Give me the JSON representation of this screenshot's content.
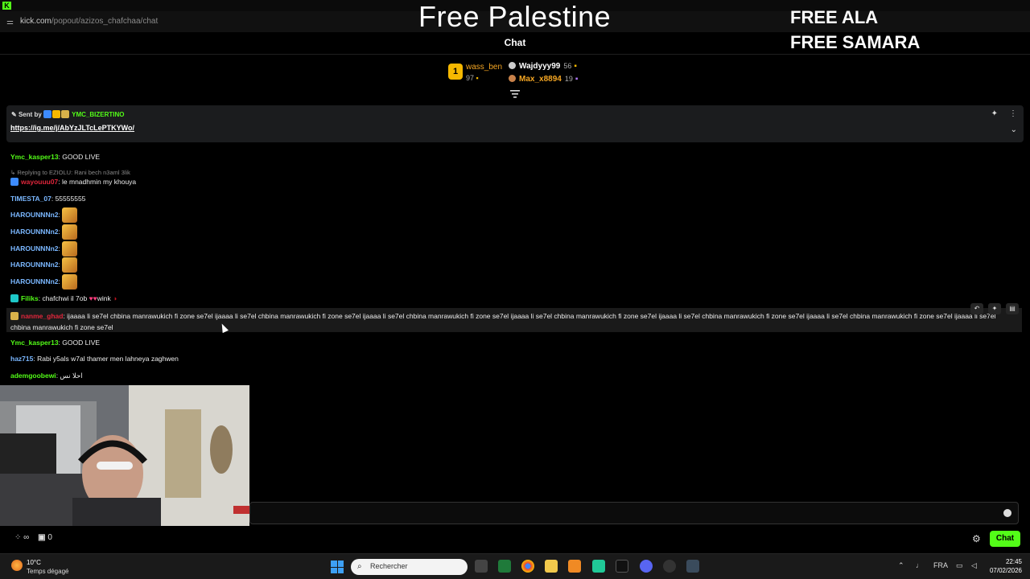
{
  "browser": {
    "url_host": "kick.com",
    "url_path": "/popout/azizos_chafchaa/chat"
  },
  "overlay": {
    "title": "Free Palestine",
    "right_lines": [
      "FREE ALA",
      "FREE SAMARA"
    ]
  },
  "chat_header": {
    "title": "Chat"
  },
  "leaderboard": {
    "first": {
      "rank": "1",
      "name": "wass_ben",
      "count": "97"
    },
    "others": [
      {
        "name": "Wajdyyy99",
        "count": "56",
        "color": "#ffffff"
      },
      {
        "name": "Max_x8894",
        "count": "19",
        "color": "#f5a623"
      }
    ]
  },
  "pinned": {
    "sent_by_label": "Sent by",
    "user": "YMC_BIZERTINO",
    "link": "https://ig.me/j/AbYzJLTcLePTKYWo/"
  },
  "messages": [
    {
      "user": "Ymc_kasper13",
      "color": "#53fc18",
      "text": ": GOOD LIVE"
    },
    {
      "reply": "Replying to EZIOLU: Rani bech n3aml 3lik"
    },
    {
      "user": "wayouuu07",
      "color": "#e0263b",
      "text": ": le mnadhmin my khouya"
    },
    {
      "user": "TIMESTA_07",
      "color": "#ffffff",
      "text": ": 55555555"
    },
    {
      "user": "HAROUNNNn2",
      "color": "#7ab7ff",
      "text": ":"
    },
    {
      "user": "HAROUNNNn2",
      "color": "#7ab7ff",
      "text": ":"
    },
    {
      "user": "HAROUNNNn2",
      "color": "#7ab7ff",
      "text": ":"
    },
    {
      "user": "HAROUNNNn2",
      "color": "#7ab7ff",
      "text": ":"
    },
    {
      "user": "HAROUNNNn2",
      "color": "#7ab7ff",
      "text": ":"
    },
    {
      "user": "Filiks",
      "color": "#53fc18",
      "text": ": chafchwi il 7ob",
      "tail": "wink"
    }
  ],
  "highlighted": {
    "user": "nanme_ghad",
    "text": ": ijaaaa li se7el chbina manrawukich fi zone se7el ijaaaa li se7el chbina manrawukich fi zone se7el ijaaaa li se7el chbina manrawukich fi zone se7el ijaaaa li se7el chbina manrawukich fi zone se7el ijaaaa li se7el chbina manrawukich fi zone se7el ijaaaa li se7el chbina manrawukich fi zone se7el ijaaaa li se7el chbina manrawukich fi zone se7el"
  },
  "messages_after": [
    {
      "user": "Ymc_kasper13",
      "color": "#53fc18",
      "text": ": GOOD LIVE"
    },
    {
      "user": "haz715",
      "color": "#7ab7ff",
      "text": ": Rabi y5als w7al thamer men lahneya zaghwen"
    },
    {
      "user": "ademgoobewi",
      "color": "#53fc18",
      "text": ": احلا نس"
    }
  ],
  "bottom": {
    "viewers_symbol": "∞",
    "count": "0",
    "chat_button": "Chat"
  },
  "taskbar": {
    "weather_temp": "10°C",
    "weather_desc": "Temps dégagé",
    "search_placeholder": "Rechercher",
    "lang": "FRA",
    "time": "22:45",
    "date": "07/02/2026"
  },
  "colors": {
    "accent": "#53fc18",
    "gold": "#f5b800"
  }
}
